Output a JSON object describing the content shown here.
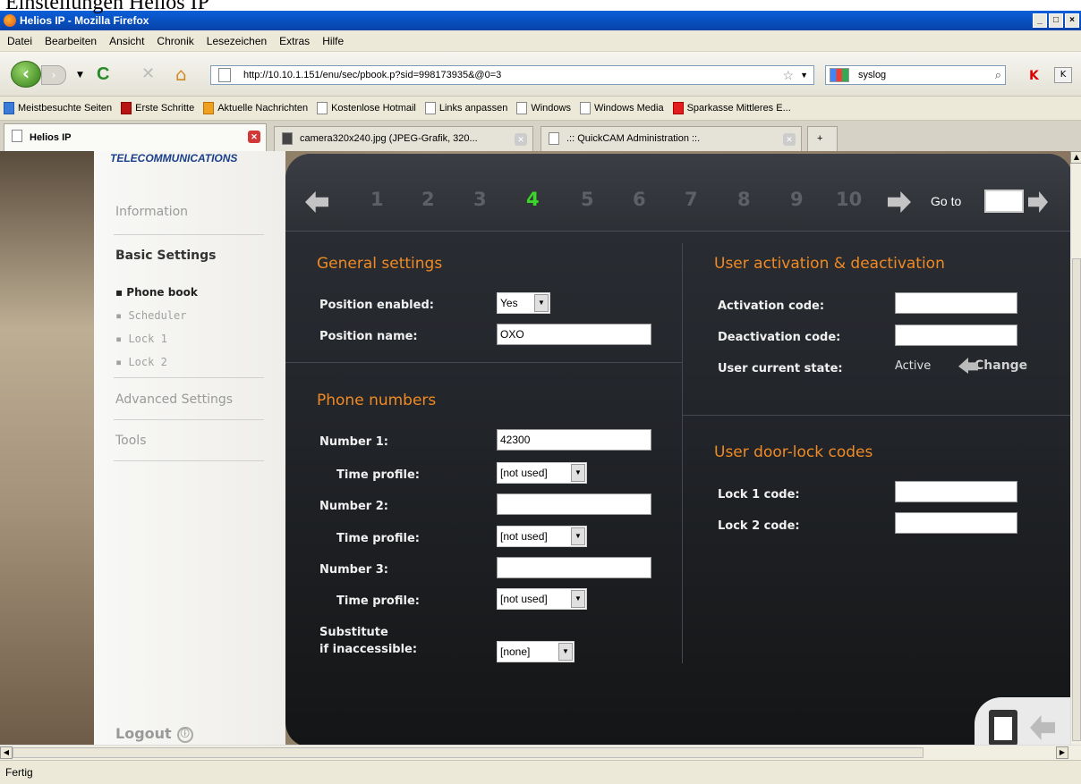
{
  "doc_title": "Einstellungen Helios IP",
  "window": {
    "title": "Helios IP - Mozilla Firefox",
    "min": "_",
    "max": "□",
    "close": "×"
  },
  "menu": [
    "Datei",
    "Bearbeiten",
    "Ansicht",
    "Chronik",
    "Lesezeichen",
    "Extras",
    "Hilfe"
  ],
  "nav": {
    "back": "‹",
    "forward": "›",
    "reload": "C",
    "stop": "✕",
    "home": "⌂",
    "url": "http://10.10.1.151/enu/sec/pbook.p?sid=998173935&@0=3",
    "search_value": "syslog"
  },
  "bookmarks": [
    "Meistbesuchte Seiten",
    "Erste Schritte",
    "Aktuelle Nachrichten",
    "Kostenlose Hotmail",
    "Links anpassen",
    "Windows",
    "Windows Media",
    "Sparkasse Mittleres E..."
  ],
  "tabs": [
    "Helios IP",
    "camera320x240.jpg (JPEG-Grafik, 320...",
    ".:: QuickCAM Administration ::."
  ],
  "sidebar": {
    "brand": "TELECOMMUNICATIONS",
    "information": "Information",
    "basic_settings": "Basic Settings",
    "sub": [
      "▪ Phone book",
      "▪ Scheduler",
      "▪ Lock 1",
      "▪ Lock 2"
    ],
    "advanced": "Advanced Settings",
    "tools": "Tools",
    "logout": "Logout",
    "logout_icon": "ⓘ"
  },
  "pager": {
    "pages": [
      "1",
      "2",
      "3",
      "4",
      "5",
      "6",
      "7",
      "8",
      "9",
      "10"
    ],
    "current": "4",
    "goto": "Go to"
  },
  "general": {
    "title": "General settings",
    "position_enabled_label": "Position enabled:",
    "position_enabled_value": "Yes",
    "position_name_label": "Position name:",
    "position_name_value": "OXO"
  },
  "phone": {
    "title": "Phone numbers",
    "number1_label": "Number 1:",
    "number1_value": "42300",
    "time_profile_label": "Time profile:",
    "time_profile_value": "[not used]",
    "number2_label": "Number 2:",
    "number2_value": "",
    "number3_label": "Number 3:",
    "number3_value": "",
    "substitute_label": "Substitute\nif inaccessible:",
    "substitute_value": "[none]"
  },
  "activation": {
    "title": "User activation & deactivation",
    "activation_label": "Activation code:",
    "deactivation_label": "Deactivation code:",
    "state_label": "User current state:",
    "state_value": "Active",
    "change": "Change"
  },
  "doorlock": {
    "title": "User door-lock codes",
    "lock1_label": "Lock 1 code:",
    "lock2_label": "Lock 2 code:"
  },
  "status": "Fertig"
}
